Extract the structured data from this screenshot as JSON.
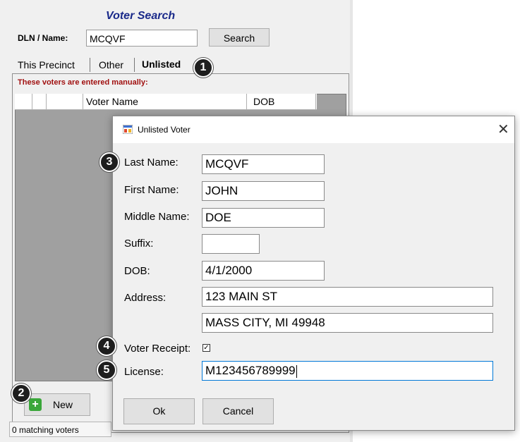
{
  "voter_search": {
    "title": "Voter Search",
    "dln_label": "DLN / Name:",
    "dln_value": "MCQVF",
    "search_label": "Search",
    "tabs": [
      "This Precinct",
      "Other",
      "Unlisted"
    ],
    "manual_note": "These voters are entered manually:",
    "grid_columns": [
      "Voter Name",
      "DOB"
    ],
    "new_label": "New",
    "status": "0 matching voters"
  },
  "dialog": {
    "title": "Unlisted Voter",
    "close_glyph": "✕",
    "labels": {
      "last_name": "Last Name:",
      "first_name": "First Name:",
      "middle_name": "Middle Name:",
      "suffix": "Suffix:",
      "dob": "DOB:",
      "address": "Address:",
      "voter_receipt": "Voter Receipt:",
      "license": "License:"
    },
    "values": {
      "last_name": "MCQVF",
      "first_name": "JOHN",
      "middle_name": "DOE",
      "suffix": "",
      "dob": "4/1/2000",
      "address_line1": "123 MAIN ST",
      "address_line2": "MASS CITY, MI 49948",
      "license": "M123456789999"
    },
    "voter_receipt_checked": true,
    "check_glyph": "✓",
    "ok_label": "Ok",
    "cancel_label": "Cancel"
  },
  "badges": [
    "1",
    "2",
    "3",
    "4",
    "5"
  ],
  "colors": {
    "title_blue": "#1a2a8a",
    "note_red": "#a01010",
    "focus_blue": "#0078d7",
    "new_green": "#3aa73a",
    "badge_black": "#1e1e1e"
  }
}
